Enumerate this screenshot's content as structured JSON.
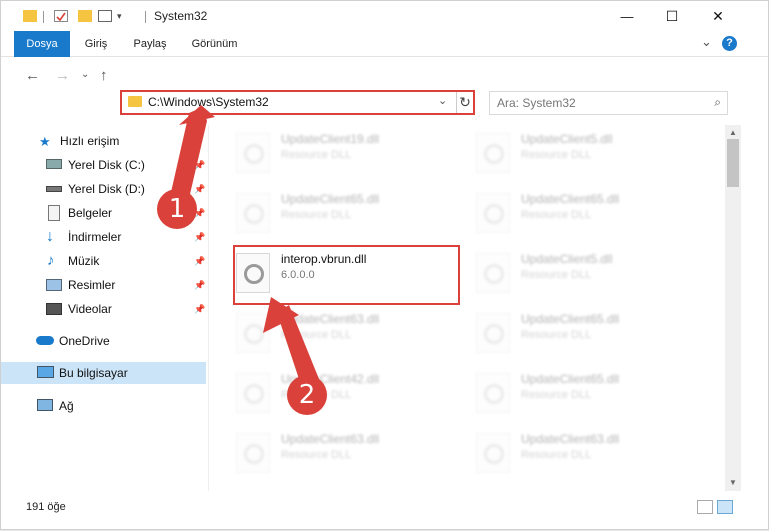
{
  "window": {
    "title": "System32",
    "minimize": "—",
    "maximize": "☐",
    "close": "✕"
  },
  "ribbon": {
    "tabs": [
      "Dosya",
      "Giriş",
      "Paylaş",
      "Görünüm"
    ],
    "collapse": "⌄",
    "help": "?"
  },
  "address": {
    "path": "C:\\Windows\\System32",
    "dropdown": "⌄",
    "refresh": "↻"
  },
  "search": {
    "placeholder": "Ara: System32",
    "icon": "⌕"
  },
  "nav": {
    "back": "←",
    "forward": "→",
    "recent": "⌄",
    "up": "↑"
  },
  "sidebar": {
    "items": [
      {
        "label": "Hızlı erişim",
        "icon": "star-icon"
      },
      {
        "label": "Yerel Disk (C:)",
        "icon": "drive-icon"
      },
      {
        "label": "Yerel Disk (D:)",
        "icon": "drive-icon"
      },
      {
        "label": "Belgeler",
        "icon": "documents-icon"
      },
      {
        "label": "İndirmeler",
        "icon": "download-icon"
      },
      {
        "label": "Müzik",
        "icon": "music-icon"
      },
      {
        "label": "Resimler",
        "icon": "pictures-icon"
      },
      {
        "label": "Videolar",
        "icon": "videos-icon"
      },
      {
        "label": "OneDrive",
        "icon": "cloud-icon"
      },
      {
        "label": "Bu bilgisayar",
        "icon": "computer-icon"
      },
      {
        "label": "Ağ",
        "icon": "network-icon"
      }
    ],
    "pin": "📌"
  },
  "files": {
    "left": [
      {
        "name": "UpdateClient19.dll",
        "desc": "Resource DLL"
      },
      {
        "name": "UpdateClient65.dll",
        "desc": "Resource DLL"
      },
      {
        "name": "interop.vbrun.dll",
        "desc": "6.0.0.0"
      },
      {
        "name": "UpdateClient63.dll",
        "desc": "Resource DLL"
      },
      {
        "name": "UpdateClient42.dll",
        "desc": "Resource DLL"
      },
      {
        "name": "UpdateClient63.dll",
        "desc": "Resource DLL"
      }
    ],
    "right": [
      {
        "name": "UpdateClient5.dll",
        "desc": "Resource DLL"
      },
      {
        "name": "UpdateClient65.dll",
        "desc": "Resource DLL"
      },
      {
        "name": "UpdateClient5.dll",
        "desc": "Resource DLL"
      },
      {
        "name": "UpdateClient65.dll",
        "desc": "Resource DLL"
      },
      {
        "name": "UpdateClient65.dll",
        "desc": "Resource DLL"
      },
      {
        "name": "UpdateClient63.dll",
        "desc": "Resource DLL"
      }
    ]
  },
  "status": {
    "count": "191 öğe"
  },
  "annotations": {
    "step1": "1",
    "step2": "2",
    "color": "#d9413a"
  }
}
